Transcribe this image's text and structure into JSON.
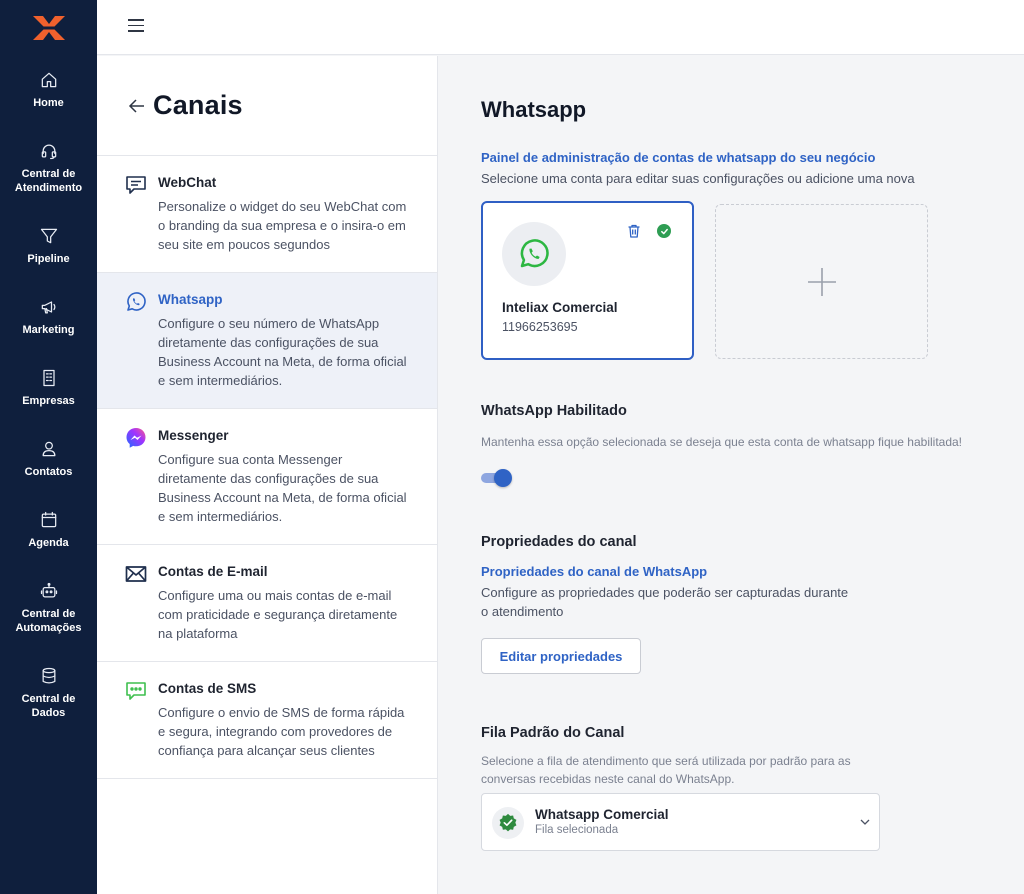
{
  "nav": {
    "items": [
      {
        "label": "Home",
        "icon": "home-icon"
      },
      {
        "label": "Central de\nAtendimento",
        "icon": "headset-icon"
      },
      {
        "label": "Pipeline",
        "icon": "funnel-icon"
      },
      {
        "label": "Marketing",
        "icon": "megaphone-icon"
      },
      {
        "label": "Empresas",
        "icon": "building-icon"
      },
      {
        "label": "Contatos",
        "icon": "person-icon"
      },
      {
        "label": "Agenda",
        "icon": "calendar-icon"
      },
      {
        "label": "Central de\nAutomações",
        "icon": "robot-icon"
      },
      {
        "label": "Central de\nDados",
        "icon": "database-icon"
      }
    ]
  },
  "colors": {
    "rail_bg": "#0f1f3d",
    "accent_blue": "#2f63c5",
    "success_green": "#2e9d53",
    "logo_orange": "#f0612d"
  },
  "channels_panel": {
    "title": "Canais",
    "items": [
      {
        "name": "WebChat",
        "description": "Personalize o widget do seu WebChat com o branding da sua empresa e o insira-o em seu site em poucos segundos",
        "icon": "chat-icon"
      },
      {
        "name": "Whatsapp",
        "description": "Configure o seu número de WhatsApp diretamente das configurações de sua Business Account na Meta, de forma oficial e sem intermediários.",
        "icon": "whatsapp-icon",
        "active": true
      },
      {
        "name": "Messenger",
        "description": "Configure sua conta Messenger diretamente das configurações de sua Business Account na Meta, de forma oficial e sem intermediários.",
        "icon": "messenger-icon"
      },
      {
        "name": "Contas de E-mail",
        "description": "Configure uma ou mais contas de e-mail com praticidade e segurança diretamente na plataforma",
        "icon": "mail-icon"
      },
      {
        "name": "Contas de SMS",
        "description": "Configure o envio de SMS de forma rápida e segura, integrando com provedores de confiança para alcançar seus clientes",
        "icon": "sms-icon"
      }
    ]
  },
  "main": {
    "title": "Whatsapp",
    "admin_link": "Painel de administração de contas de whatsapp do seu negócio",
    "admin_desc": "Selecione uma conta para editar suas configurações ou adicione uma nova",
    "account": {
      "name": "Inteliax Comercial",
      "phone": "11966253695"
    },
    "enabled_title": "WhatsApp Habilitado",
    "enabled_desc": "Mantenha essa opção selecionada se deseja que esta conta de whatsapp fique habilitada!",
    "enabled": true,
    "props_title": "Propriedades do canal",
    "props_link": "Propriedades do canal de WhatsApp",
    "props_desc": "Configure as propriedades que poderão ser capturadas durante o atendimento",
    "edit_props_button": "Editar propriedades",
    "queue_title": "Fila Padrão do Canal",
    "queue_desc": "Selecione a fila de atendimento que será utilizada por padrão para as conversas recebidas neste canal do WhatsApp.",
    "queue_selected": "Whatsapp Comercial",
    "queue_selected_sub": "Fila selecionada"
  }
}
